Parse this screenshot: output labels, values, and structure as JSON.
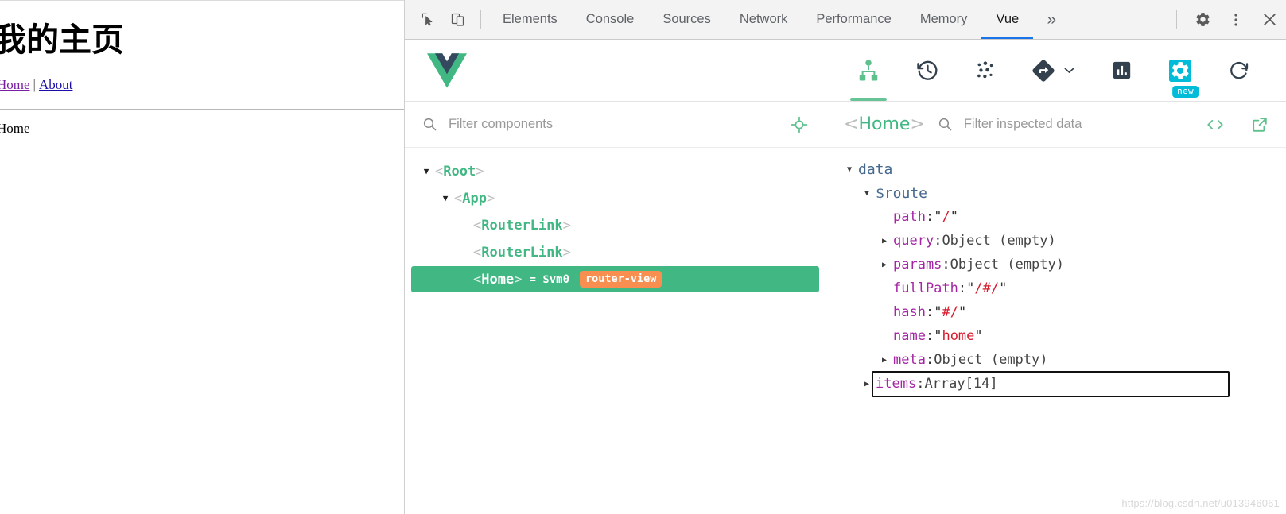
{
  "page": {
    "heading": "我的主页",
    "nav": {
      "home": "Home",
      "separator": "|",
      "about": "About"
    },
    "body_text": "Home"
  },
  "devtools": {
    "toolbar_icons": {
      "inspect": "cursor-select-icon",
      "device": "device-toolbar-icon",
      "settings": "gear-icon",
      "kebab": "more-vertical-icon",
      "close": "close-icon"
    },
    "tabs": [
      {
        "label": "Elements",
        "active": false
      },
      {
        "label": "Console",
        "active": false
      },
      {
        "label": "Sources",
        "active": false
      },
      {
        "label": "Network",
        "active": false
      },
      {
        "label": "Performance",
        "active": false
      },
      {
        "label": "Memory",
        "active": false
      },
      {
        "label": "Vue",
        "active": true
      }
    ],
    "more_tabs_label": "»"
  },
  "vue_toolbar": {
    "logo": "vue-logo",
    "items": [
      {
        "name": "components-tab",
        "icon": "component-tree-icon",
        "active": true
      },
      {
        "name": "timeline-tab",
        "icon": "history-clock-icon",
        "active": false
      },
      {
        "name": "vuex-tab",
        "icon": "vuex-dots-icon",
        "active": false
      },
      {
        "name": "routing-tab",
        "icon": "routing-diamond-icon",
        "active": false
      },
      {
        "name": "performance-tab",
        "icon": "bar-chart-icon",
        "active": false
      },
      {
        "name": "settings-tab",
        "icon": "gear-icon",
        "active": false,
        "badge": "new"
      },
      {
        "name": "refresh-button",
        "icon": "refresh-icon",
        "active": false
      }
    ]
  },
  "tree_pane": {
    "filter": {
      "value": "",
      "placeholder": "Filter components"
    },
    "select_icon": "target-crosshair-icon",
    "rows": [
      {
        "name": "Root",
        "depth": 0,
        "caret": "▼",
        "selected": false,
        "vm": "",
        "badge": ""
      },
      {
        "name": "App",
        "depth": 1,
        "caret": "▼",
        "selected": false,
        "vm": "",
        "badge": ""
      },
      {
        "name": "RouterLink",
        "depth": 2,
        "caret": "",
        "selected": false,
        "vm": "",
        "badge": ""
      },
      {
        "name": "RouterLink",
        "depth": 2,
        "caret": "",
        "selected": false,
        "vm": "",
        "badge": ""
      },
      {
        "name": "Home",
        "depth": 2,
        "caret": "",
        "selected": true,
        "vm": "= $vm0",
        "badge": "router-view"
      }
    ]
  },
  "inspect_pane": {
    "inspected_component": "Home",
    "filter": {
      "value": "",
      "placeholder": "Filter inspected data"
    },
    "code_icon": "angle-brackets-icon",
    "open_icon": "external-link-icon",
    "rows": [
      {
        "type": "group",
        "caret": "▼",
        "indent": 0,
        "label": "data"
      },
      {
        "type": "group",
        "caret": "▼",
        "indent": 1,
        "label": "$route"
      },
      {
        "type": "kv",
        "caret": "",
        "indent": 2,
        "key": "path",
        "value": "\"/\"",
        "value_kind": "string"
      },
      {
        "type": "kv",
        "caret": "▶",
        "indent": 2,
        "key": "query",
        "value": "Object (empty)",
        "value_kind": "object"
      },
      {
        "type": "kv",
        "caret": "▶",
        "indent": 2,
        "key": "params",
        "value": "Object (empty)",
        "value_kind": "object"
      },
      {
        "type": "kv",
        "caret": "",
        "indent": 2,
        "key": "fullPath",
        "value": "\"/#/\"",
        "value_kind": "string"
      },
      {
        "type": "kv",
        "caret": "",
        "indent": 2,
        "key": "hash",
        "value": "\"#/\"",
        "value_kind": "string"
      },
      {
        "type": "kv",
        "caret": "",
        "indent": 2,
        "key": "name",
        "value": "\"home\"",
        "value_kind": "string"
      },
      {
        "type": "kv",
        "caret": "▶",
        "indent": 2,
        "key": "meta",
        "value": "Object (empty)",
        "value_kind": "object"
      },
      {
        "type": "kv",
        "caret": "▶",
        "indent": 1,
        "key": "items",
        "value": "Array[14]",
        "value_kind": "object",
        "annotated": true
      }
    ]
  },
  "watermark": "https://blog.csdn.net/u013946061",
  "colors": {
    "vue_green": "#41b883",
    "vue_dark": "#35495e",
    "chrome_blue": "#1a73e8",
    "badge_cyan": "#00bcd9",
    "router_view_orange": "#f98e51",
    "key_purple": "#a426a4",
    "string_red": "#d8192b"
  }
}
